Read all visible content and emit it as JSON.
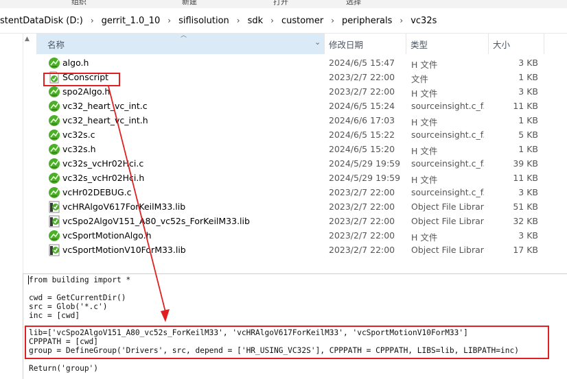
{
  "ribbon": {
    "group1": "组织",
    "group2": "新建",
    "group3": "打开",
    "group4": "选择"
  },
  "breadcrumb": [
    "stentDataDisk (D:)",
    "gerrit_1.0_10",
    "siflisolution",
    "sdk",
    "customer",
    "peripherals",
    "vc32s"
  ],
  "breadcrumb_separator": "›",
  "columns": {
    "name": "名称",
    "modified": "修改日期",
    "type": "类型",
    "size": "大小"
  },
  "files": [
    {
      "name": "algo.h",
      "date": "2024/6/5 15:47",
      "type": "H 文件",
      "size": "3 KB",
      "icon": "sourceinsight-file-icon"
    },
    {
      "name": "SConscript",
      "date": "2023/2/7 22:00",
      "type": "文件",
      "size": "1 KB",
      "icon": "generic-file-icon"
    },
    {
      "name": "spo2Algo.h",
      "date": "2023/2/7 22:00",
      "type": "H 文件",
      "size": "3 KB",
      "icon": "sourceinsight-file-icon"
    },
    {
      "name": "vc32_heart_vc_int.c",
      "date": "2024/6/5 15:24",
      "type": "sourceinsight.c_f...",
      "size": "11 KB",
      "icon": "sourceinsight-file-icon"
    },
    {
      "name": "vc32_heart_vc_int.h",
      "date": "2024/6/6 17:03",
      "type": "H 文件",
      "size": "1 KB",
      "icon": "sourceinsight-file-icon"
    },
    {
      "name": "vc32s.c",
      "date": "2024/6/5 15:22",
      "type": "sourceinsight.c_f...",
      "size": "5 KB",
      "icon": "sourceinsight-file-icon"
    },
    {
      "name": "vc32s.h",
      "date": "2024/6/5 15:20",
      "type": "H 文件",
      "size": "1 KB",
      "icon": "sourceinsight-file-icon"
    },
    {
      "name": "vc32s_vcHr02Hci.c",
      "date": "2024/5/29 19:59",
      "type": "sourceinsight.c_f...",
      "size": "39 KB",
      "icon": "sourceinsight-file-icon"
    },
    {
      "name": "vc32s_vcHr02Hci.h",
      "date": "2024/5/29 19:59",
      "type": "H 文件",
      "size": "11 KB",
      "icon": "sourceinsight-file-icon"
    },
    {
      "name": "vcHr02DEBUG.c",
      "date": "2023/2/7 22:00",
      "type": "sourceinsight.c_f...",
      "size": "3 KB",
      "icon": "sourceinsight-file-icon"
    },
    {
      "name": "vcHRAlgoV617ForKeilM33.lib",
      "date": "2023/2/7 22:00",
      "type": "Object File Library",
      "size": "51 KB",
      "icon": "library-file-icon"
    },
    {
      "name": "vcSpo2AlgoV151_A80_vc52s_ForKeilM33.lib",
      "date": "2023/2/7 22:00",
      "type": "Object File Library",
      "size": "32 KB",
      "icon": "library-file-icon"
    },
    {
      "name": "vcSportMotionAlgo.h",
      "date": "2023/2/7 22:00",
      "type": "H 文件",
      "size": "3 KB",
      "icon": "sourceinsight-file-icon"
    },
    {
      "name": "vcSportMotionV10ForM33.lib",
      "date": "2023/2/7 22:00",
      "type": "Object File Library",
      "size": "17 KB",
      "icon": "library-file-icon"
    }
  ],
  "code": {
    "block1": "from building import *\n\ncwd = GetCurrentDir()\nsrc = Glob('*.c')\ninc = [cwd]",
    "block2": "lib=['vcSpo2AlgoV151_A80_vc52s_ForKeilM33', 'vcHRAlgoV617ForKeilM33', 'vcSportMotionV10ForM33']\nCPPPATH = [cwd]\ngroup = DefineGroup('Drivers', src, depend = ['HR_USING_VC32S'], CPPPATH = CPPPATH, LIBS=lib, LIBPATH=inc)",
    "block3": "Return('group')"
  },
  "colors": {
    "annotation": "#e02020",
    "sort_column_bg": "#dbeaf7",
    "icon_green": "#4caf2a"
  }
}
